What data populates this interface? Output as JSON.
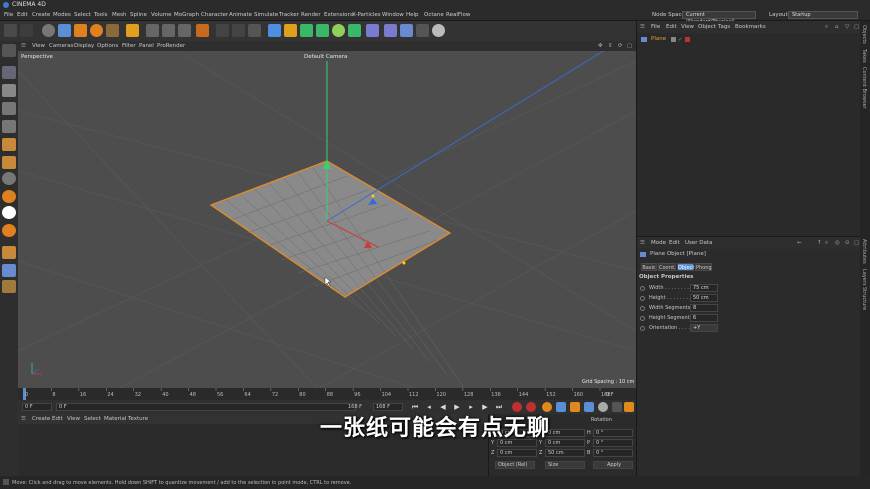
{
  "app": {
    "title": "CINEMA 4D"
  },
  "menubar": {
    "items": [
      "File",
      "Edit",
      "Create",
      "Modes",
      "Select",
      "Tools",
      "Mesh",
      "Spline",
      "Volume",
      "MoGraph",
      "Character",
      "Animate",
      "Simulate",
      "Tracker",
      "Render",
      "Extensions",
      "X-Particles",
      "Window",
      "Help",
      "Octane",
      "RealFlow"
    ],
    "node_space_label": "Node Space:",
    "node_space_value": "Current (Standard/Physical)",
    "layout_label": "Layout:",
    "layout_value": "Startup"
  },
  "viewport": {
    "menu": [
      "View",
      "Cameras",
      "Display",
      "Options",
      "Filter",
      "Panel",
      "ProRender"
    ],
    "name": "Perspective",
    "camera": "Default Camera",
    "grid_spacing": "Grid Spacing : 10 cm"
  },
  "timeline": {
    "ticks": [
      "0",
      "8",
      "16",
      "24",
      "32",
      "40",
      "48",
      "56",
      "64",
      "72",
      "80",
      "88",
      "96",
      "104",
      "112",
      "120",
      "128",
      "136",
      "144",
      "152",
      "160",
      "168"
    ],
    "end_label": "0 F"
  },
  "transport": {
    "current_frame": "0 F",
    "start_frame": "0 F",
    "end_frame": "168 F",
    "end_frame2": "168 F"
  },
  "material_manager": {
    "menu": [
      "Create",
      "Edit",
      "View",
      "Select",
      "Material",
      "Texture"
    ]
  },
  "coordinates": {
    "header": "Rotation",
    "rows": [
      {
        "axis": "X",
        "pos": "0 cm",
        "axis2": "X",
        "size": "0 cm",
        "axis3": "H",
        "rot": "0 °"
      },
      {
        "axis": "Y",
        "pos": "0 cm",
        "axis2": "Y",
        "size": "0 cm",
        "axis3": "P",
        "rot": "0 °"
      },
      {
        "axis": "Z",
        "pos": "0 cm",
        "axis2": "Z",
        "size": "50 cm",
        "axis3": "B",
        "rot": "0 °"
      }
    ],
    "mode_select": "Object (Rel)",
    "size_select": "Size",
    "apply": "Apply"
  },
  "object_manager": {
    "menu": [
      "File",
      "Edit",
      "View",
      "Object",
      "Tags",
      "Bookmarks"
    ],
    "items": [
      {
        "name": "Plane"
      }
    ]
  },
  "attributes": {
    "menu": [
      "Mode",
      "Edit",
      "User Data"
    ],
    "object_title": "Plane Object [Plane]",
    "tabs": [
      "Basic",
      "Coord.",
      "Object",
      "Phong"
    ],
    "active_tab": "Object",
    "section": "Object Properties",
    "properties": [
      {
        "label": "Width . . . . . . . . . .",
        "value": "75 cm"
      },
      {
        "label": "Height . . . . . . . . .",
        "value": "50 cm"
      },
      {
        "label": "Width Segments",
        "value": "8"
      },
      {
        "label": "Height Segments",
        "value": "6"
      },
      {
        "label": "Orientation . . . . . .",
        "value": "+Y"
      }
    ]
  },
  "side_tabs": [
    "Objects",
    "Takes",
    "Content Browser",
    "Attributes",
    "Layers",
    "Structure"
  ],
  "status": "Move: Click and drag to move elements. Hold down SHIFT to quantize movement / add to the selection in point mode, CTRL to remove.",
  "subtitle": "一张纸可能会有点无聊"
}
